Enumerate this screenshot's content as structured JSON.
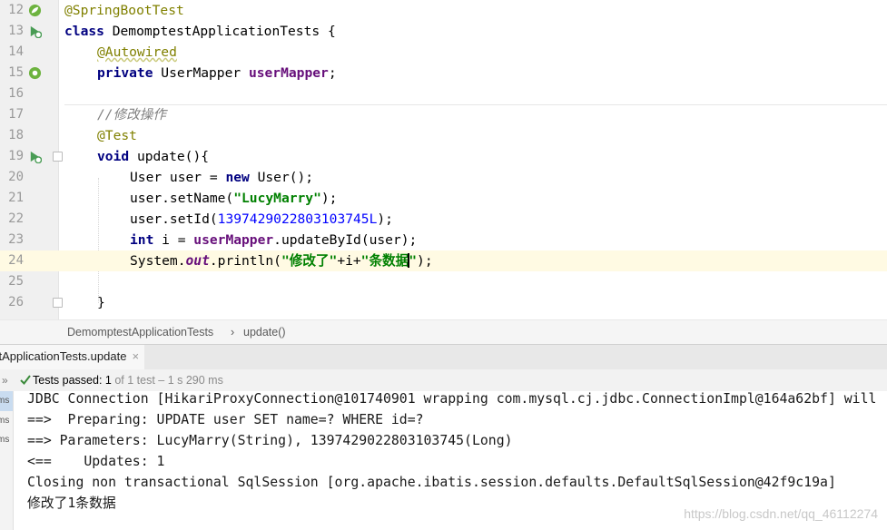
{
  "editor": {
    "line_numbers": [
      "12",
      "13",
      "14",
      "15",
      "16",
      "17",
      "18",
      "19",
      "20",
      "21",
      "22",
      "23",
      "24",
      "25",
      "26"
    ],
    "lines": {
      "l12": {
        "ann": "@SpringBootTest"
      },
      "l13": {
        "kw": "class",
        "rest": " DemomptestApplicationTests {"
      },
      "l14": {
        "ann": "@Autowired"
      },
      "l15": {
        "kw": "private",
        "type": " UserMapper ",
        "field": "userMapper",
        "end": ";"
      },
      "l17": {
        "comment": "//修改操作"
      },
      "l18": {
        "ann": "@Test"
      },
      "l19": {
        "kw": "void",
        "rest": " update(){"
      },
      "l20": {
        "a": "User user = ",
        "kw": "new",
        "b": " User();"
      },
      "l21": {
        "a": "user.setName(",
        "str": "\"LucyMarry\"",
        "b": ");"
      },
      "l22": {
        "a": "user.setId(",
        "num": "1397429022803103745L",
        "b": ");"
      },
      "l23": {
        "kw": "int",
        "a": " i = ",
        "field": "userMapper",
        "b": ".updateById(user);"
      },
      "l24": {
        "a": "System.",
        "sfield": "out",
        "b": ".println(",
        "str1": "\"修改了\"",
        "c": "+i+",
        "str2a": "\"条数据",
        "str2b": "\"",
        "d": ");"
      },
      "l26": {
        "rest": "}"
      }
    }
  },
  "breadcrumb": {
    "class_name": "DemomptestApplicationTests",
    "separator": "›",
    "method": "update()"
  },
  "run_tab": {
    "label": "stApplicationTests.update",
    "close": "×"
  },
  "test_status": {
    "chevron": "»",
    "passed_label": "Tests passed: ",
    "passed_count": "1",
    "rest": " of 1 test – 1 s 290 ms"
  },
  "left_strip": {
    "items": [
      "ms",
      "ms",
      "ms"
    ]
  },
  "console": {
    "lines": [
      "JDBC Connection [HikariProxyConnection@101740901 wrapping com.mysql.cj.jdbc.ConnectionImpl@164a62bf] will",
      "==>  Preparing: UPDATE user SET name=? WHERE id=?",
      "==> Parameters: LucyMarry(String), 1397429022803103745(Long)",
      "<==    Updates: 1",
      "Closing non transactional SqlSession [org.apache.ibatis.session.defaults.DefaultSqlSession@42f9c19a]",
      "修改了1条数据"
    ]
  },
  "watermark": "https://blog.csdn.net/qq_46112274",
  "colors": {
    "annotation": "#808000",
    "keyword": "#000080",
    "field": "#660e7a",
    "string": "#008000",
    "number": "#0000ff",
    "comment": "#808080",
    "passed": "#3a8a3a"
  }
}
